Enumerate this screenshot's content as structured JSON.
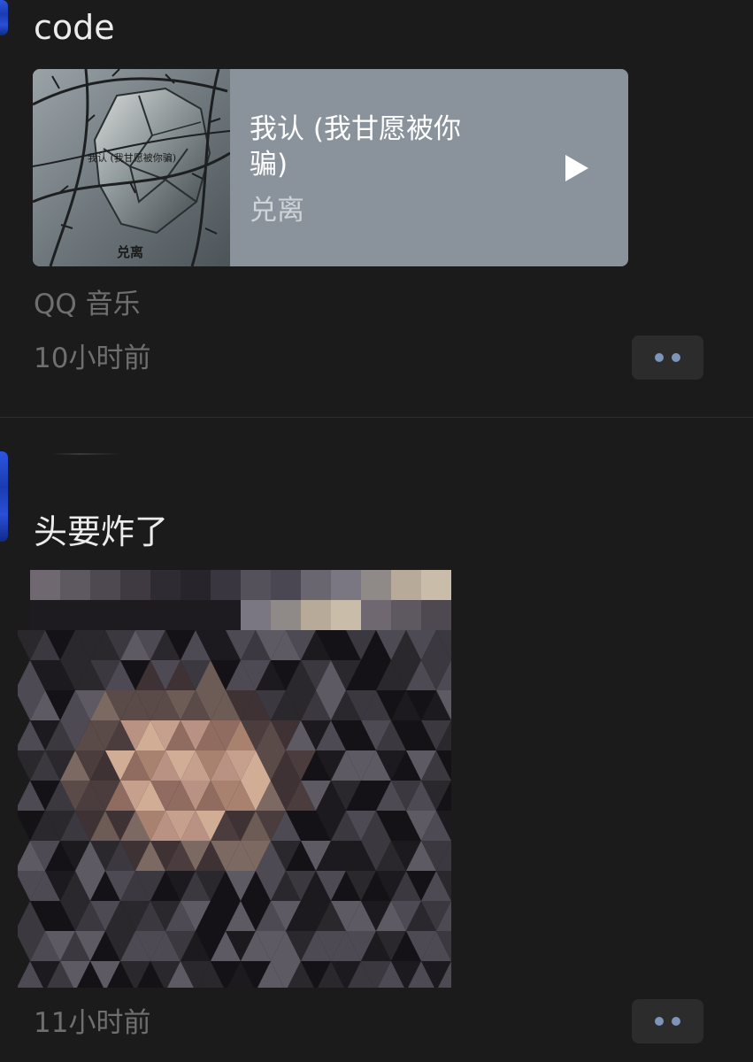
{
  "posts": [
    {
      "text": "code",
      "music_card": {
        "album_title": "我认 (我甘愿被你骗)",
        "album_artist": "兑离",
        "song_title": "我认 (我甘愿被你骗)",
        "song_artist": "兑离",
        "play_icon": "play-icon"
      },
      "source": "QQ 音乐",
      "time": "10小时前",
      "more_icon": "more-dots-icon"
    },
    {
      "text": "头要炸了",
      "image": "pixelated-photo",
      "time": "11小时前",
      "more_icon": "more-dots-icon"
    }
  ],
  "colors": {
    "background": "#1b1b1b",
    "card": "#8a939c",
    "accent_dots": "#7c95b8",
    "secondary_text": "#6f6f6f"
  }
}
